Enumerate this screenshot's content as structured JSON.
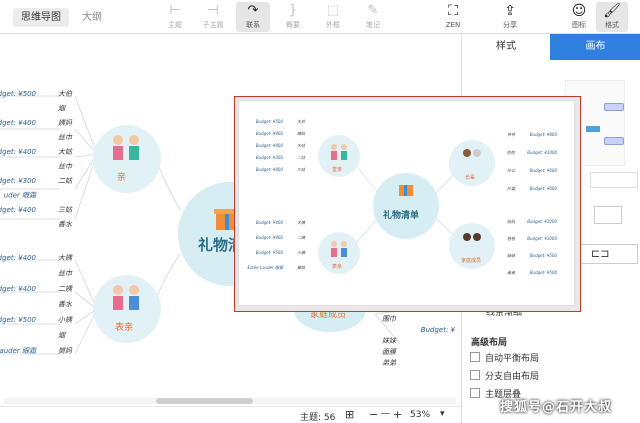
{
  "view_tabs": {
    "mindmap": "思维导图",
    "outline": "大纲"
  },
  "toolbar": {
    "topic": "主题",
    "subtopic": "子主题",
    "link": "联系",
    "summary": "概要",
    "boundary": "外框",
    "note": "笔记",
    "zen": "ZEN",
    "share": "分享",
    "icon": "图标",
    "format": "格式"
  },
  "panel": {
    "tab_style": "样式",
    "tab_canvas": "画布",
    "line_taper": "线条渐细",
    "advanced_layout": "高级布局",
    "auto_balance": "自动平衡布局",
    "free_layout": "分支自由布局",
    "main_structure": "主题层叠",
    "colors": {
      "accent": "#2f7fe0"
    }
  },
  "status": {
    "topic_count_label": "主题: 56",
    "zoom": "53%"
  },
  "map": {
    "central": "礼物清单",
    "left_top": "亲",
    "left_bottom": "表亲",
    "right_top": "家庭成员",
    "lt_items": [
      {
        "b": "Budget: ¥500",
        "n": "大伯"
      },
      {
        "b": "",
        "n": "烟"
      },
      {
        "b": "Budget: ¥400",
        "n": "姨妈"
      },
      {
        "b": "",
        "n": "丝巾"
      },
      {
        "b": "Budget: ¥400",
        "n": "大姑"
      },
      {
        "b": "",
        "n": "丝巾"
      },
      {
        "b": "Budget: ¥300",
        "n": "二姑"
      },
      {
        "b": "uder 眼霜",
        "n": ""
      },
      {
        "b": "Budget: ¥400",
        "n": "三姑"
      },
      {
        "b": "",
        "n": "香水"
      }
    ],
    "lb_items": [
      {
        "b": "Budget: ¥400",
        "n": "大姨"
      },
      {
        "b": "",
        "n": "丝巾"
      },
      {
        "b": "Budget: ¥400",
        "n": "二姨"
      },
      {
        "b": "",
        "n": "香水"
      },
      {
        "b": "Budget: ¥500",
        "n": "小姨"
      },
      {
        "b": "",
        "n": "烟"
      },
      {
        "b": "Lauder 眼霜",
        "n": "舅妈"
      }
    ],
    "rt_items": [
      {
        "b": "Budget: ¥",
        "n": ""
      },
      {
        "b": "",
        "n": "围巾"
      },
      {
        "b": "Budget: ¥",
        "n": ""
      },
      {
        "b": "",
        "n": "妹妹"
      },
      {
        "b": "",
        "n": "面膜"
      },
      {
        "b": "",
        "n": "弟弟"
      }
    ]
  },
  "preview": {
    "central": "礼物清单",
    "l1": "堂亲",
    "l2": "表亲",
    "r1": "长辈",
    "r2": "家庭成员",
    "l1_items": [
      {
        "b": "Budget: ¥500",
        "n": "大伯"
      },
      {
        "b": "Budget: ¥400",
        "n": "姨妈"
      },
      {
        "b": "Budget: ¥400",
        "n": "大姑"
      },
      {
        "b": "Budget: ¥300",
        "n": "二姑"
      },
      {
        "b": "Budget: ¥400",
        "n": "三姑"
      }
    ],
    "l2_items": [
      {
        "b": "Budget: ¥400",
        "n": "大姨"
      },
      {
        "b": "Budget: ¥400",
        "n": "二姨"
      },
      {
        "b": "Budget: ¥500",
        "n": "小姨"
      },
      {
        "b": "Estée Lauder 眼霜",
        "n": "舅妈"
      }
    ],
    "r1_items": [
      {
        "b": "Budget: ¥800",
        "n": "爷爷"
      },
      {
        "b": "Budget: ¥1000",
        "n": "奶奶"
      },
      {
        "b": "Budget: ¥600",
        "n": "外公"
      },
      {
        "b": "Budget: ¥600",
        "n": "外婆"
      }
    ],
    "r2_items": [
      {
        "b": "Budget: ¥1000",
        "n": "妈妈"
      },
      {
        "b": "Budget: ¥1000",
        "n": "爸爸"
      },
      {
        "b": "Budget: ¥500",
        "n": "妹妹"
      },
      {
        "b": "Budget: ¥500",
        "n": "弟弟"
      }
    ]
  },
  "watermark": "搜狐号@石开大叔"
}
